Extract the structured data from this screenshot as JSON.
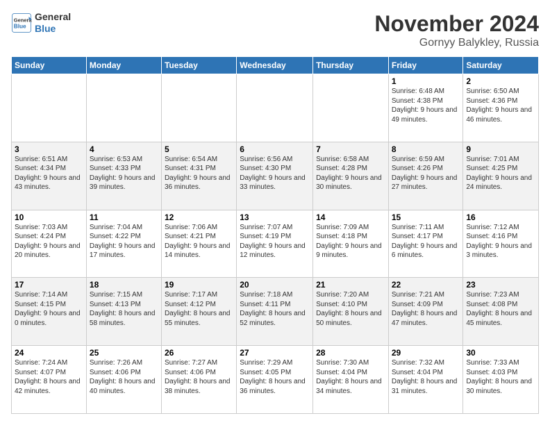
{
  "logo": {
    "line1": "General",
    "line2": "Blue"
  },
  "title": "November 2024",
  "subtitle": "Gornyy Balykley, Russia",
  "days_of_week": [
    "Sunday",
    "Monday",
    "Tuesday",
    "Wednesday",
    "Thursday",
    "Friday",
    "Saturday"
  ],
  "weeks": [
    [
      {
        "day": "",
        "info": ""
      },
      {
        "day": "",
        "info": ""
      },
      {
        "day": "",
        "info": ""
      },
      {
        "day": "",
        "info": ""
      },
      {
        "day": "",
        "info": ""
      },
      {
        "day": "1",
        "info": "Sunrise: 6:48 AM\nSunset: 4:38 PM\nDaylight: 9 hours and 49 minutes."
      },
      {
        "day": "2",
        "info": "Sunrise: 6:50 AM\nSunset: 4:36 PM\nDaylight: 9 hours and 46 minutes."
      }
    ],
    [
      {
        "day": "3",
        "info": "Sunrise: 6:51 AM\nSunset: 4:34 PM\nDaylight: 9 hours and 43 minutes."
      },
      {
        "day": "4",
        "info": "Sunrise: 6:53 AM\nSunset: 4:33 PM\nDaylight: 9 hours and 39 minutes."
      },
      {
        "day": "5",
        "info": "Sunrise: 6:54 AM\nSunset: 4:31 PM\nDaylight: 9 hours and 36 minutes."
      },
      {
        "day": "6",
        "info": "Sunrise: 6:56 AM\nSunset: 4:30 PM\nDaylight: 9 hours and 33 minutes."
      },
      {
        "day": "7",
        "info": "Sunrise: 6:58 AM\nSunset: 4:28 PM\nDaylight: 9 hours and 30 minutes."
      },
      {
        "day": "8",
        "info": "Sunrise: 6:59 AM\nSunset: 4:26 PM\nDaylight: 9 hours and 27 minutes."
      },
      {
        "day": "9",
        "info": "Sunrise: 7:01 AM\nSunset: 4:25 PM\nDaylight: 9 hours and 24 minutes."
      }
    ],
    [
      {
        "day": "10",
        "info": "Sunrise: 7:03 AM\nSunset: 4:24 PM\nDaylight: 9 hours and 20 minutes."
      },
      {
        "day": "11",
        "info": "Sunrise: 7:04 AM\nSunset: 4:22 PM\nDaylight: 9 hours and 17 minutes."
      },
      {
        "day": "12",
        "info": "Sunrise: 7:06 AM\nSunset: 4:21 PM\nDaylight: 9 hours and 14 minutes."
      },
      {
        "day": "13",
        "info": "Sunrise: 7:07 AM\nSunset: 4:19 PM\nDaylight: 9 hours and 12 minutes."
      },
      {
        "day": "14",
        "info": "Sunrise: 7:09 AM\nSunset: 4:18 PM\nDaylight: 9 hours and 9 minutes."
      },
      {
        "day": "15",
        "info": "Sunrise: 7:11 AM\nSunset: 4:17 PM\nDaylight: 9 hours and 6 minutes."
      },
      {
        "day": "16",
        "info": "Sunrise: 7:12 AM\nSunset: 4:16 PM\nDaylight: 9 hours and 3 minutes."
      }
    ],
    [
      {
        "day": "17",
        "info": "Sunrise: 7:14 AM\nSunset: 4:15 PM\nDaylight: 9 hours and 0 minutes."
      },
      {
        "day": "18",
        "info": "Sunrise: 7:15 AM\nSunset: 4:13 PM\nDaylight: 8 hours and 58 minutes."
      },
      {
        "day": "19",
        "info": "Sunrise: 7:17 AM\nSunset: 4:12 PM\nDaylight: 8 hours and 55 minutes."
      },
      {
        "day": "20",
        "info": "Sunrise: 7:18 AM\nSunset: 4:11 PM\nDaylight: 8 hours and 52 minutes."
      },
      {
        "day": "21",
        "info": "Sunrise: 7:20 AM\nSunset: 4:10 PM\nDaylight: 8 hours and 50 minutes."
      },
      {
        "day": "22",
        "info": "Sunrise: 7:21 AM\nSunset: 4:09 PM\nDaylight: 8 hours and 47 minutes."
      },
      {
        "day": "23",
        "info": "Sunrise: 7:23 AM\nSunset: 4:08 PM\nDaylight: 8 hours and 45 minutes."
      }
    ],
    [
      {
        "day": "24",
        "info": "Sunrise: 7:24 AM\nSunset: 4:07 PM\nDaylight: 8 hours and 42 minutes."
      },
      {
        "day": "25",
        "info": "Sunrise: 7:26 AM\nSunset: 4:06 PM\nDaylight: 8 hours and 40 minutes."
      },
      {
        "day": "26",
        "info": "Sunrise: 7:27 AM\nSunset: 4:06 PM\nDaylight: 8 hours and 38 minutes."
      },
      {
        "day": "27",
        "info": "Sunrise: 7:29 AM\nSunset: 4:05 PM\nDaylight: 8 hours and 36 minutes."
      },
      {
        "day": "28",
        "info": "Sunrise: 7:30 AM\nSunset: 4:04 PM\nDaylight: 8 hours and 34 minutes."
      },
      {
        "day": "29",
        "info": "Sunrise: 7:32 AM\nSunset: 4:04 PM\nDaylight: 8 hours and 31 minutes."
      },
      {
        "day": "30",
        "info": "Sunrise: 7:33 AM\nSunset: 4:03 PM\nDaylight: 8 hours and 30 minutes."
      }
    ]
  ]
}
